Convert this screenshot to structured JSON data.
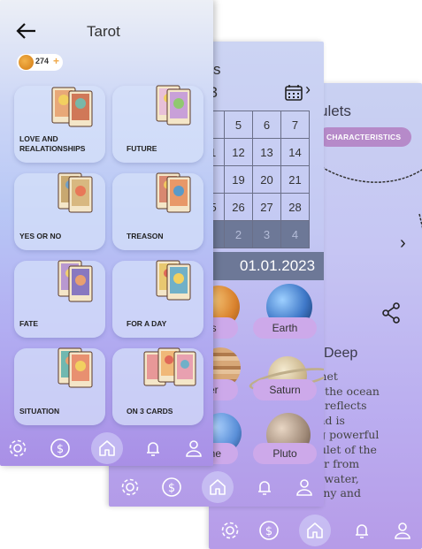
{
  "back_screen": {
    "title": "ulets",
    "chip": "CHARACTERISTICS",
    "chevron": "›",
    "heading": "Deep",
    "text": "et thet\nc of the ocean\none reflects\nn and is\nning powerful\nAmulet of the\nwner from\ns of water,\nrmony and",
    "icons": [
      "share-icon",
      "chevron-right-icon",
      "necklace-image"
    ]
  },
  "middle_screen": {
    "title": "lets",
    "month": "23",
    "next": "›",
    "calendar": {
      "rows": [
        [
          "4",
          "5",
          "6",
          "7"
        ],
        [
          "11",
          "12",
          "13",
          "14"
        ],
        [
          "8",
          "19",
          "20",
          "21"
        ],
        [
          "25",
          "26",
          "27",
          "28"
        ],
        [
          "1",
          "2",
          "3",
          "4"
        ]
      ]
    },
    "date_label": "e",
    "date": "01.01.2023",
    "planets": [
      {
        "name": "nus",
        "color": "#e0a04a"
      },
      {
        "name": "Earth",
        "color": "#3f78c8"
      },
      {
        "name": "piter",
        "color": "#c8905a"
      },
      {
        "name": "Saturn",
        "color": "#d8c8a0"
      },
      {
        "name": "ptune",
        "color": "#5a8fd8"
      },
      {
        "name": "Pluto",
        "color": "#a08a78"
      }
    ]
  },
  "front_screen": {
    "title": "Tarot",
    "coins": "274",
    "coins_plus": "+",
    "tiles": [
      {
        "label": "LOVE AND\nREALATIONSHIPS",
        "color": "#e8a878"
      },
      {
        "label": "FUTURE",
        "color": "#e8c0d8"
      },
      {
        "label": "YES OR NO",
        "color": "#c8a870"
      },
      {
        "label": "TREASON",
        "color": "#d88870"
      },
      {
        "label": "FATE",
        "color": "#b898d0"
      },
      {
        "label": "FOR A DAY",
        "color": "#e8c870"
      },
      {
        "label": "SITUATION",
        "color": "#70b8b0"
      },
      {
        "label": "ON 3 CARDS",
        "color": "#e89898"
      }
    ]
  },
  "nav": {
    "items": [
      "settings-icon",
      "dollar-icon",
      "home-icon",
      "bell-icon",
      "profile-icon"
    ]
  }
}
